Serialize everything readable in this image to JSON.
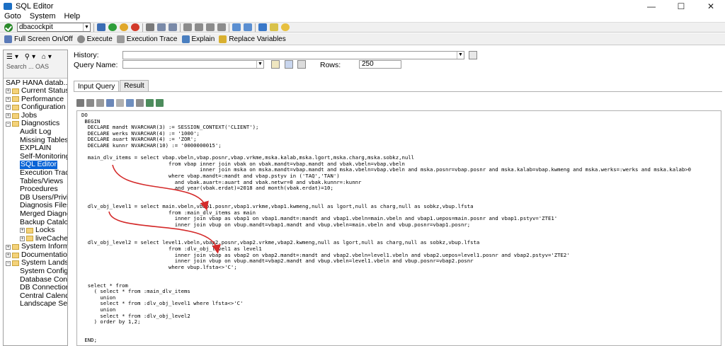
{
  "window": {
    "title": "SQL Editor",
    "minimize": "—",
    "maximize": "☐",
    "close": "✕"
  },
  "menu": [
    "Goto",
    "System",
    "Help"
  ],
  "toolbar": {
    "command_value": "dbacockpit"
  },
  "toolbar2": {
    "full_screen": "Full Screen On/Off",
    "execute": "Execute",
    "execution_trace": "Execution Trace",
    "explain": "Explain",
    "replace_variables": "Replace Variables"
  },
  "left_panel": {
    "search_label": "Search ... OAS",
    "root": "SAP HANA datab...",
    "items": [
      {
        "label": "Current Status",
        "level": 0,
        "expander": "+",
        "folder": true
      },
      {
        "label": "Performance",
        "level": 0,
        "expander": "+",
        "folder": true
      },
      {
        "label": "Configuration",
        "level": 0,
        "expander": "+",
        "folder": true
      },
      {
        "label": "Jobs",
        "level": 0,
        "expander": "+",
        "folder": true
      },
      {
        "label": "Diagnostics",
        "level": 0,
        "expander": "−",
        "folder": true
      },
      {
        "label": "Audit Log",
        "level": 1
      },
      {
        "label": "Missing Tables",
        "level": 1
      },
      {
        "label": "EXPLAIN",
        "level": 1
      },
      {
        "label": "Self-Monitoring",
        "level": 1
      },
      {
        "label": "SQL Editor",
        "level": 1,
        "selected": true
      },
      {
        "label": "Execution Trace",
        "level": 1
      },
      {
        "label": "Tables/Views",
        "level": 1
      },
      {
        "label": "Procedures",
        "level": 1
      },
      {
        "label": "DB Users/Privile",
        "level": 1
      },
      {
        "label": "Diagnosis Files",
        "level": 1
      },
      {
        "label": "Merged Diagno",
        "level": 1
      },
      {
        "label": "Backup Catalog",
        "level": 1
      },
      {
        "label": "Locks",
        "level": 1,
        "expander": "+",
        "folder": true
      },
      {
        "label": "liveCache Ob",
        "level": 1,
        "expander": "+",
        "folder": true
      },
      {
        "label": "System Informa",
        "level": 0,
        "expander": "+",
        "folder": true
      },
      {
        "label": "Documentation",
        "level": 0,
        "expander": "+",
        "folder": true
      },
      {
        "label": "System Landsca",
        "level": 0,
        "expander": "−",
        "folder": true
      },
      {
        "label": "System Configu",
        "level": 1
      },
      {
        "label": "Database Conne",
        "level": 1
      },
      {
        "label": "DB Connection",
        "level": 1
      },
      {
        "label": "Central Calenda",
        "level": 1
      },
      {
        "label": "Landscape Self-",
        "level": 1
      }
    ]
  },
  "query_panel": {
    "history_label": "History:",
    "history_value": "",
    "query_name_label": "Query Name:",
    "query_name_value": "",
    "rows_label": "Rows:",
    "rows_value": "250"
  },
  "tabs": [
    {
      "label": "Input Query",
      "active": true
    },
    {
      "label": "Result",
      "active": false
    }
  ],
  "code": "DO\n BEGIN\n  DECLARE mandt NVARCHAR(3) := SESSION_CONTEXT('CLIENT');\n  DECLARE werks NVARCHAR(4) := '1000';\n  DECLARE auart NVARCHAR(4) := 'ZOR';\n  DECLARE kunnr NVARCHAR(10) := '0000000015';\n\n  main_dlv_items = select vbap.vbeln,vbap.posnr,vbap.vrkme,mska.kalab,mska.lgort,mska.charg,mska.sobkz,null\n                            from vbap inner join vbak on vbak.mandt=vbap.mandt and vbak.vbeln=vbap.vbeln\n                                      inner join mska on mska.mandt=vbap.mandt and mska.vbeln=vbap.vbeln and mska.posnr=vbap.posnr and mska.kalab=vbap.kwmeng and mska.werks=:werks and mska.kalab>0\n                            where vbap.mandt=:mandt and vbap.pstyv in ('TAQ','TAN')\n                              and vbak.auart=:auart and vbak.netwr=0 and vbak.kunnr=:kunnr\n                              and year(vbak.erdat)=2018 and month(vbak.erdat)=10;\n\n\n  dlv_obj_level1 = select main.vbeln,vbap1.posnr,vbap1.vrkme,vbap1.kwmeng,null as lgort,null as charg,null as sobkz,vbup.lfsta\n                            from :main_dlv_items as main\n                              inner join vbap as vbap1 on vbap1.mandt=:mandt and vbap1.vbeln=main.vbeln and vbap1.uepos=main.posnr and vbap1.pstyv='ZTE1'\n                              inner join vbup on vbup.mandt=vbap1.mandt and vbup.vbeln=main.vbeln and vbup.posnr=vbap1.posnr;\n\n\n  dlv_obj_level2 = select level1.vbeln,vbap2.posnr,vbap2.vrkme,vbap2.kwmeng,null as lgort,null as charg,null as sobkz,vbup.lfsta\n                            from :dlv_obj_level1 as level1\n                              inner join vbap as vbap2 on vbap2.mandt=:mandt and vbap2.vbeln=level1.vbeln and vbap2.uepos=level1.posnr and vbap2.pstyv='ZTE2'\n                              inner join vbup on vbup.mandt=vbap2.mandt and vbup.vbeln=level1.vbeln and vbup.posnr=vbap2.posnr\n                            where vbup.lfsta<>'C';\n\n\n  select * from\n    ( select * from :main_dlv_items\n      union\n      select * from :dlv_obj_level1 where lfsta<>'C'\n      union\n      select * from :dlv_obj_level2\n    ) order by 1,2;\n\n\n END;"
}
